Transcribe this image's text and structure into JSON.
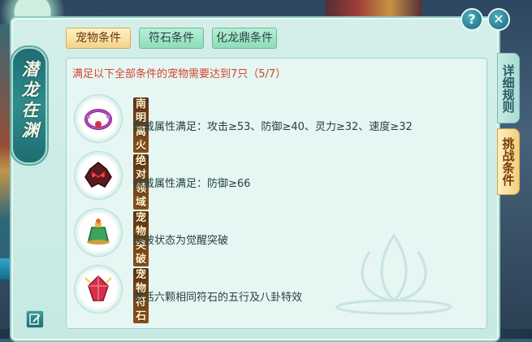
{
  "banner": {
    "title": "潜龙在渊"
  },
  "tabs": [
    {
      "label": "宠物条件",
      "active": true
    },
    {
      "label": "符石条件",
      "active": false
    },
    {
      "label": "化龙鼎条件",
      "active": false
    }
  ],
  "side_tabs": [
    {
      "label": "详细规则",
      "active": false
    },
    {
      "label": "挑战条件",
      "active": true
    }
  ],
  "requirement": {
    "text": "满足以下全部条件的宠物需要达到7只（5/7）"
  },
  "conditions": [
    {
      "name": "南明离火",
      "description": "佩戴属性满足：攻击≥53、防御≥40、灵力≥32、速度≥32",
      "icon": "ring-icon"
    },
    {
      "name": "绝对领域",
      "description": "佩戴属性满足：防御≥66",
      "icon": "dragon-mask-icon"
    },
    {
      "name": "宠物突破",
      "description": "突破状态为觉醒突破",
      "icon": "jade-pot-icon"
    },
    {
      "name": "宠物符石",
      "description": "激活六颗相同符石的五行及八卦特效",
      "icon": "crystal-icon"
    }
  ],
  "buttons": {
    "help": "?",
    "close": "✕"
  },
  "colors": {
    "window_bg": "#d4efe9",
    "requirement_text": "#d4452b",
    "active_tab": "#f2d48c",
    "inactive_tab": "#8fdcb9"
  }
}
